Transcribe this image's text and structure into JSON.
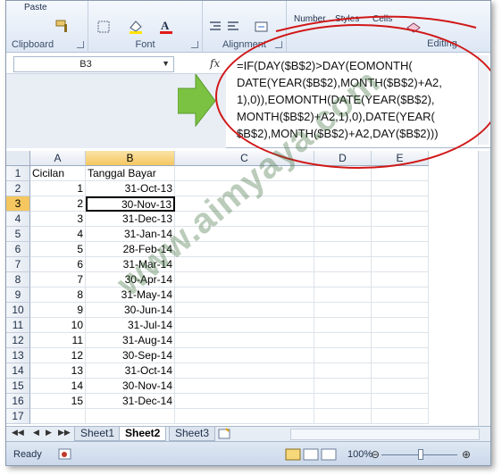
{
  "ribbon": {
    "paste_label": "Paste",
    "groups": {
      "clipboard": "Clipboard",
      "font": "Font",
      "alignment": "Alignment",
      "editing": "Editing"
    },
    "number_label": "Number",
    "styles_label": "Styles",
    "cells_label": "Cells"
  },
  "formula_bar": {
    "name_box": "B3",
    "fx": "fx",
    "formula": "=IF(DAY($B$2)>DAY(EOMONTH(\nDATE(YEAR($B$2),MONTH($B$2)+A2,\n1),0)),EOMONTH(DATE(YEAR($B$2),\nMONTH($B$2)+A2,1),0),DATE(YEAR(\n$B$2),MONTH($B$2)+A2,DAY($B$2)))"
  },
  "grid": {
    "columns": [
      "A",
      "B",
      "C",
      "D",
      "E"
    ],
    "rows": [
      {
        "n": "1",
        "a": "Cicilan",
        "b": "Tanggal Bayar"
      },
      {
        "n": "2",
        "a": "1",
        "b": "31-Oct-13"
      },
      {
        "n": "3",
        "a": "2",
        "b": "30-Nov-13"
      },
      {
        "n": "4",
        "a": "3",
        "b": "31-Dec-13"
      },
      {
        "n": "5",
        "a": "4",
        "b": "31-Jan-14"
      },
      {
        "n": "6",
        "a": "5",
        "b": "28-Feb-14"
      },
      {
        "n": "7",
        "a": "6",
        "b": "31-Mar-14"
      },
      {
        "n": "8",
        "a": "7",
        "b": "30-Apr-14"
      },
      {
        "n": "9",
        "a": "8",
        "b": "31-May-14"
      },
      {
        "n": "10",
        "a": "9",
        "b": "30-Jun-14"
      },
      {
        "n": "11",
        "a": "10",
        "b": "31-Jul-14"
      },
      {
        "n": "12",
        "a": "11",
        "b": "31-Aug-14"
      },
      {
        "n": "13",
        "a": "12",
        "b": "30-Sep-14"
      },
      {
        "n": "14",
        "a": "13",
        "b": "31-Oct-14"
      },
      {
        "n": "15",
        "a": "14",
        "b": "30-Nov-14"
      },
      {
        "n": "16",
        "a": "15",
        "b": "31-Dec-14"
      },
      {
        "n": "17",
        "a": "",
        "b": ""
      }
    ],
    "active_cell": "B3"
  },
  "sheets": {
    "tabs": [
      "Sheet1",
      "Sheet2",
      "Sheet3"
    ],
    "active": "Sheet2"
  },
  "status": {
    "ready": "Ready",
    "zoom": "100%"
  },
  "watermark": "www.aimyaya.com",
  "colors": {
    "annotation_red": "#d01818",
    "arrow_green": "#7cc242",
    "selection_gold": "#f5c760"
  }
}
